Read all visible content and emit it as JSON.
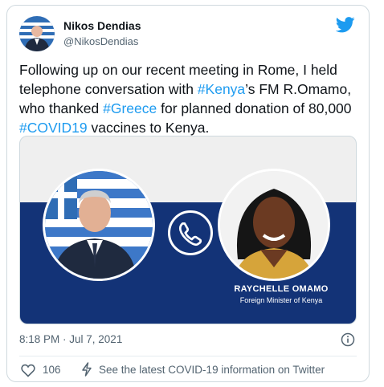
{
  "author": {
    "display_name": "Nikos Dendias",
    "handle": "@NikosDendias",
    "avatar_icon": "avatar-photo"
  },
  "tweet": {
    "segments": [
      {
        "text": "Following up on our recent meeting in Rome, I held telephone conversation with ",
        "hashtag": false
      },
      {
        "text": "#Kenya",
        "hashtag": true
      },
      {
        "text": "’s FM R.Omamo, who thanked ",
        "hashtag": false
      },
      {
        "text": "#Greece",
        "hashtag": true
      },
      {
        "text": " for planned donation of 80,000 ",
        "hashtag": false
      },
      {
        "text": "#COVID19",
        "hashtag": true
      },
      {
        "text": " vaccines to Kenya.",
        "hashtag": false
      }
    ]
  },
  "media": {
    "caption_name": "RAYCHELLE OMAMO",
    "caption_role": "Foreign Minister of Kenya",
    "center_icon": "phone-icon"
  },
  "meta": {
    "timestamp": "8:18 PM · Jul 7, 2021",
    "like_count": "106",
    "covid_link": "See the latest COVID-19 information on Twitter"
  },
  "colors": {
    "link": "#1d9bf0",
    "band": "#133377",
    "muted": "#536471"
  }
}
